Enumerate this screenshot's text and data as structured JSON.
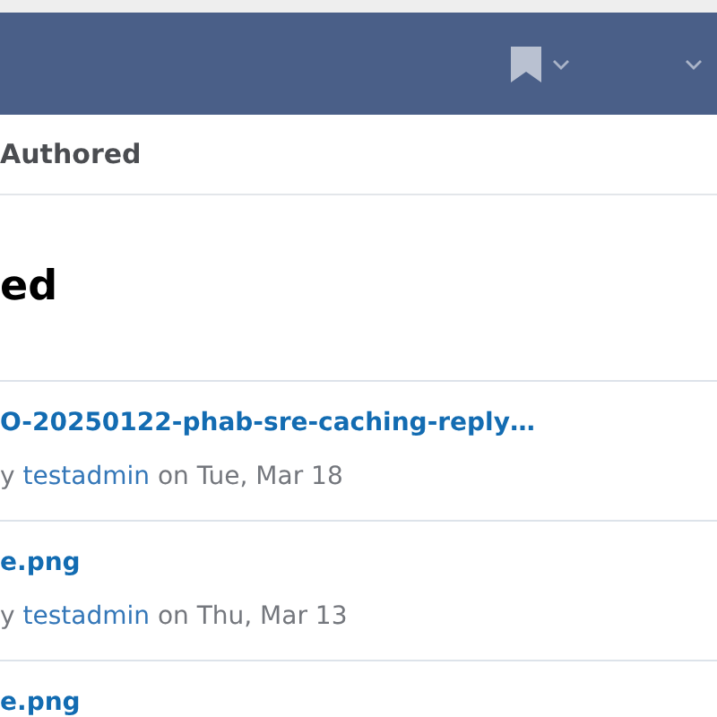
{
  "navbar": {
    "menus": [
      {
        "kind": "bookmark"
      },
      {
        "kind": "blank"
      }
    ]
  },
  "tab": {
    "label": "Authored"
  },
  "heading": "ed",
  "items": [
    {
      "title": "O-20250122-phab-sre-caching-reply…",
      "prefix": "y",
      "author": "testadmin",
      "date": "on Tue, Mar 18"
    },
    {
      "title": "e.png",
      "prefix": "y",
      "author": "testadmin",
      "date": "on Thu, Mar 13"
    },
    {
      "title": "e.png"
    }
  ]
}
